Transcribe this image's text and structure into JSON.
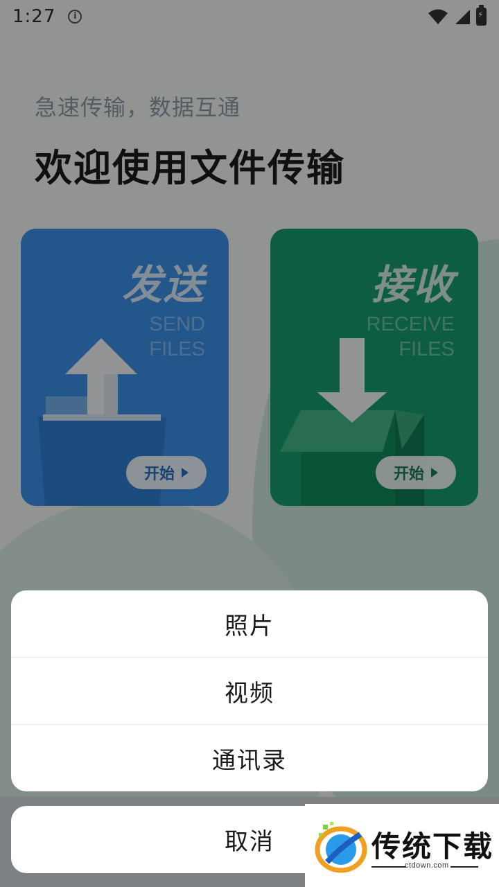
{
  "status_bar": {
    "time": "1:27",
    "info_icon": "info-circle-icon",
    "wifi_icon": "wifi-icon",
    "signal_icon": "cell-signal-icon",
    "battery_icon": "battery-charging-icon"
  },
  "header": {
    "subtitle": "急速传输，数据互通",
    "title": "欢迎使用文件传输"
  },
  "cards": [
    {
      "title": "发送",
      "en_line1": "SEND",
      "en_line2": "FILES",
      "button": "开始",
      "icon": "upload-arrow-icon",
      "color": "#3b8fe6"
    },
    {
      "title": "接收",
      "en_line1": "RECEIVE",
      "en_line2": "FILES",
      "button": "开始",
      "icon": "download-box-icon",
      "color": "#179d6c"
    }
  ],
  "action_sheet": {
    "options": [
      {
        "label": "照片"
      },
      {
        "label": "视频"
      },
      {
        "label": "通讯录"
      }
    ],
    "cancel_label": "取消"
  },
  "watermark": {
    "name": "传统下载",
    "domain": "ctdown.com"
  }
}
